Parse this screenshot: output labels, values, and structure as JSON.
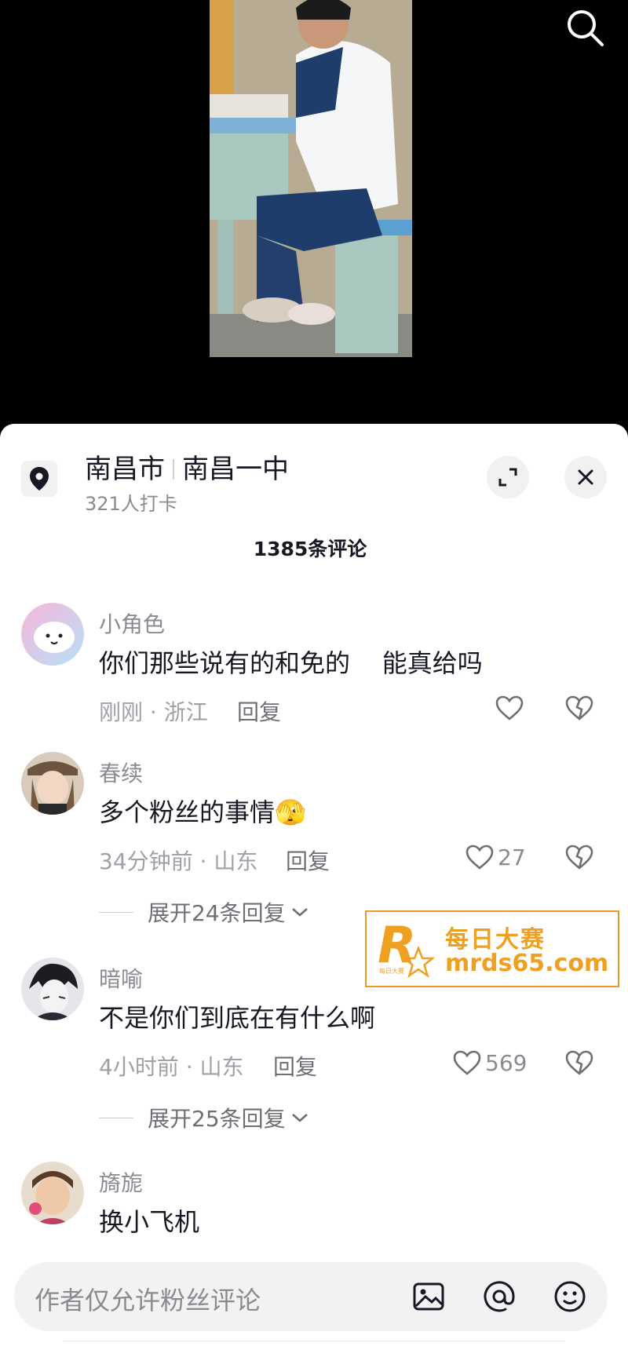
{
  "location": {
    "city": "南昌市",
    "place": "南昌一中",
    "checkins": "321人打卡"
  },
  "comments_header": {
    "count_label": "1385条评论"
  },
  "comments": [
    {
      "user": "小角色",
      "text": "你们那些说有的和免的    能真给吗",
      "meta": "刚刚 · 浙江",
      "reply_label": "回复",
      "likes": ""
    },
    {
      "user": "春续",
      "text": "多个粉丝的事情",
      "emoji": "🫣",
      "meta": "34分钟前 · 山东",
      "reply_label": "回复",
      "likes": "27",
      "expand_label": "展开24条回复"
    },
    {
      "user": "暗喻",
      "text": "不是你们到底在有什么啊",
      "meta": "4小时前 · 山东",
      "reply_label": "回复",
      "likes": "569",
      "expand_label": "展开25条回复"
    },
    {
      "user": "旖旎",
      "text": "换小飞机"
    }
  ],
  "watermark": {
    "logo_letter": "R",
    "cn_name": "每日大赛",
    "url": "mrds65.com",
    "small_text": "每日大赛"
  },
  "input": {
    "placeholder": "作者仅允许粉丝评论"
  },
  "icons": {
    "search": "search-icon",
    "location": "location-pin-icon",
    "expand": "expand-icon",
    "close": "close-icon",
    "like": "heart-icon",
    "dislike": "broken-heart-icon",
    "chevron": "chevron-down-icon",
    "image": "image-icon",
    "mention": "at-icon",
    "emoji": "emoji-icon"
  },
  "colors": {
    "watermark_orange": "#f0a020",
    "text_primary": "#161823",
    "text_secondary": "#8a8b91"
  }
}
